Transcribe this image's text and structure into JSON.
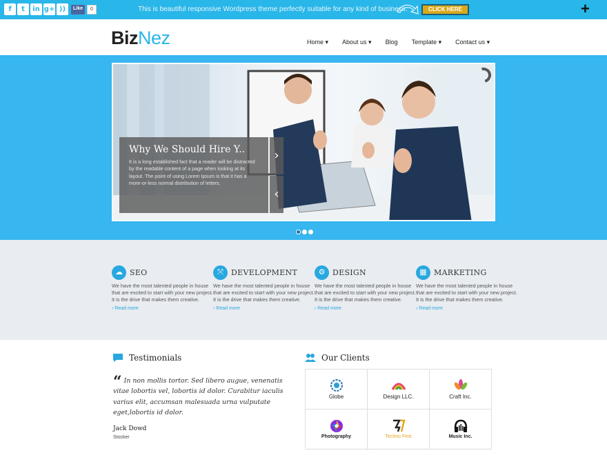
{
  "topbar": {
    "social": [
      {
        "icon": "facebook-icon",
        "glyph": "f"
      },
      {
        "icon": "twitter-icon",
        "glyph": "t"
      },
      {
        "icon": "linkedin-icon",
        "glyph": "in"
      },
      {
        "icon": "google-plus-icon",
        "glyph": "g+"
      },
      {
        "icon": "rss-icon",
        "glyph": "))"
      }
    ],
    "fb_like_label": "Like",
    "fb_like_count": "0",
    "message": "This is beautiful responsive Wordpress theme perfectly suitable for any kind of business.",
    "cta_label": "CLICK HERE",
    "toggle_glyph": "+",
    "mini_tab_glyph": "-"
  },
  "header": {
    "logo_part1": "Biz",
    "logo_part2": "Nez",
    "nav": [
      "Home ▾",
      "About us ▾",
      "Blog",
      "Template ▾",
      "Contact us ▾"
    ]
  },
  "slider": {
    "caption_title": "Why We Should Hire Y..",
    "caption_text": "It is a long established fact that a reader will be distracted by the readable content of a page when looking at its layout. The point of using Lorem Ipsum is that it has a more-or-less normal distribution of letters.",
    "next_glyph": "›",
    "prev_glyph": "‹",
    "dots": [
      true,
      false,
      false
    ]
  },
  "services": [
    {
      "title": "SEO",
      "icon": "cloud-icon",
      "glyph": "☁",
      "text": "We have the most talented people in house that are excited to start with your new project. It is the drive that makes them creative.",
      "more": "› Read more"
    },
    {
      "title": "DEVELOPMENT",
      "icon": "expand-arrows-icon",
      "glyph": "⤧",
      "text": "We have the most talented people in house that are excited to start with your new project. It is the drive that makes them creative.",
      "more": "› Read more"
    },
    {
      "title": "DESIGN",
      "icon": "gears-icon",
      "glyph": "⚙",
      "text": "We have the most talented people in house that are excited to start with your new project. It is the drive that makes them creative.",
      "more": "› Read more"
    },
    {
      "title": "MARKETING",
      "icon": "grid-icon",
      "glyph": "▦",
      "text": "We have the most talented people in house that are excited to start with your new project. It is the drive that makes them creative.",
      "more": "› Read more"
    }
  ],
  "testimonials": {
    "title": "Testimonials",
    "quote_mark": "“",
    "quote": "In non mollis tortor. Sed libero augue, venenatis vitae lobortis vel, lobortis id dolor. Curabitur iaculis varius elit, accumsan malesuada urna vulputate eget,lobortis id dolor.",
    "author": "Jack Dowd",
    "role": "Stocker"
  },
  "clients": {
    "title": "Our Clients",
    "items": [
      {
        "name": "Globe",
        "icon": "globe-logo-icon",
        "color": "#1e6fb8"
      },
      {
        "name": "Design LLC.",
        "icon": "design-llc-logo-icon",
        "color": "#e63a7d"
      },
      {
        "name": "Craft Inc.",
        "icon": "lotus-logo-icon",
        "color": "#d94b8e"
      },
      {
        "name": "Photography",
        "icon": "aperture-logo-icon",
        "color": "#8a2be2"
      },
      {
        "name": "Techno Fest",
        "icon": "techno-fest-logo-icon",
        "color": "#e8a21c"
      },
      {
        "name": "Music Inc.",
        "icon": "headphones-logo-icon",
        "color": "#111111"
      }
    ]
  }
}
